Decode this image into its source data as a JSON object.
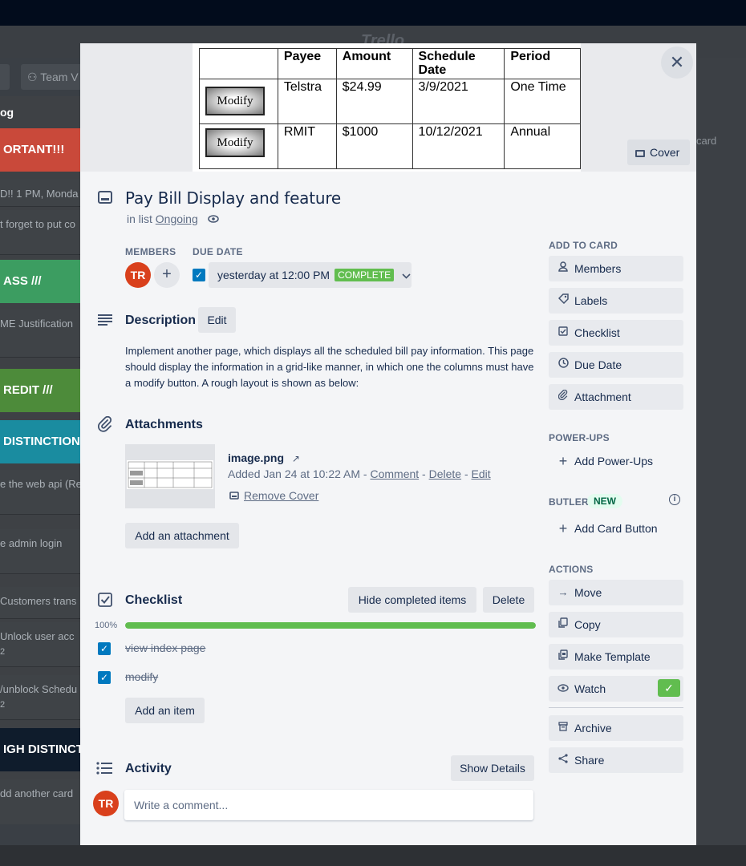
{
  "background": {
    "logo": "Trello",
    "team_button": "Team V",
    "list_title": "og",
    "labels": [
      {
        "text": "ORTANT!!!",
        "color": "#c9493a"
      },
      {
        "text": "ASS ///",
        "color": "#3c9d61"
      },
      {
        "text": "REDIT ///",
        "color": "#4d8b3a"
      },
      {
        "text": "DISTINCTION /",
        "color": "#1a8ca0"
      },
      {
        "text": "IGH DISTINCT",
        "color": "#0f1c2c"
      }
    ],
    "cards": [
      "D!! 1 PM, Monda",
      "t forget to put co",
      "ME Justification",
      "e the web api (Re",
      "e admin login",
      "Customers trans",
      "Unlock user acc",
      "/unblock Schedu",
      "dd another card"
    ],
    "card_badges": [
      "2",
      "2"
    ],
    "right_add_card": "card"
  },
  "cover": {
    "table": {
      "headers": [
        "",
        "Payee",
        "Amount",
        "Schedule Date",
        "Period"
      ],
      "rows": [
        {
          "button": "Modify",
          "payee": "Telstra",
          "amount": "$24.99",
          "date": "3/9/2021",
          "period": "One Time"
        },
        {
          "button": "Modify",
          "payee": "RMIT",
          "amount": "$1000",
          "date": "10/12/2021",
          "period": "Annual"
        }
      ]
    },
    "cover_button": "Cover"
  },
  "card": {
    "title": "Pay Bill Display and feature",
    "in_list_prefix": "in list",
    "list_name": "Ongoing",
    "members_label": "MEMBERS",
    "member_initials": "TR",
    "due_label": "DUE DATE",
    "due_text": "yesterday at 12:00 PM",
    "due_status": "COMPLETE"
  },
  "description": {
    "title": "Description",
    "edit_label": "Edit",
    "text": "Implement another page, which displays all the scheduled bill pay information. This page should display the information in a grid-like manner, in which one the columns must have a modify button. A rough layout is shown as below:"
  },
  "attachments": {
    "title": "Attachments",
    "file_name": "image.png",
    "added_text": "Added Jan 24 at 10:22 AM - ",
    "comment_link": "Comment",
    "delete_link": "Delete",
    "edit_link": "Edit",
    "remove_cover": "Remove Cover",
    "add_label": "Add an attachment"
  },
  "checklist": {
    "title": "Checklist",
    "hide_label": "Hide completed items",
    "delete_label": "Delete",
    "progress_text": "100%",
    "progress": 1.0,
    "items": [
      {
        "text": "view index page",
        "checked": true
      },
      {
        "text": "modify",
        "checked": true
      }
    ],
    "add_item_label": "Add an item"
  },
  "activity": {
    "title": "Activity",
    "show_details": "Show Details",
    "user_initials": "TR",
    "comment_placeholder": "Write a comment..."
  },
  "sidebar": {
    "add_to_card_label": "ADD TO CARD",
    "add_to_card": [
      {
        "label": "Members",
        "icon": "person-icon"
      },
      {
        "label": "Labels",
        "icon": "tag-icon"
      },
      {
        "label": "Checklist",
        "icon": "checklist-icon"
      },
      {
        "label": "Due Date",
        "icon": "clock-icon"
      },
      {
        "label": "Attachment",
        "icon": "paperclip-icon"
      }
    ],
    "powerups_label": "POWER-UPS",
    "add_powerups": "Add Power-Ups",
    "butler_label": "BUTLER",
    "new_badge": "NEW",
    "add_card_button": "Add Card Button",
    "actions_label": "ACTIONS",
    "actions": [
      {
        "label": "Move",
        "icon": "arrow-right-icon"
      },
      {
        "label": "Copy",
        "icon": "copy-icon"
      },
      {
        "label": "Make Template",
        "icon": "template-icon"
      },
      {
        "label": "Watch",
        "icon": "eye-icon"
      },
      {
        "label": "Archive",
        "icon": "archive-icon"
      },
      {
        "label": "Share",
        "icon": "share-icon"
      }
    ]
  },
  "colors": {
    "accent_blue": "#0079bf",
    "success_green": "#61bd4f",
    "avatar_red": "#d9401c"
  }
}
